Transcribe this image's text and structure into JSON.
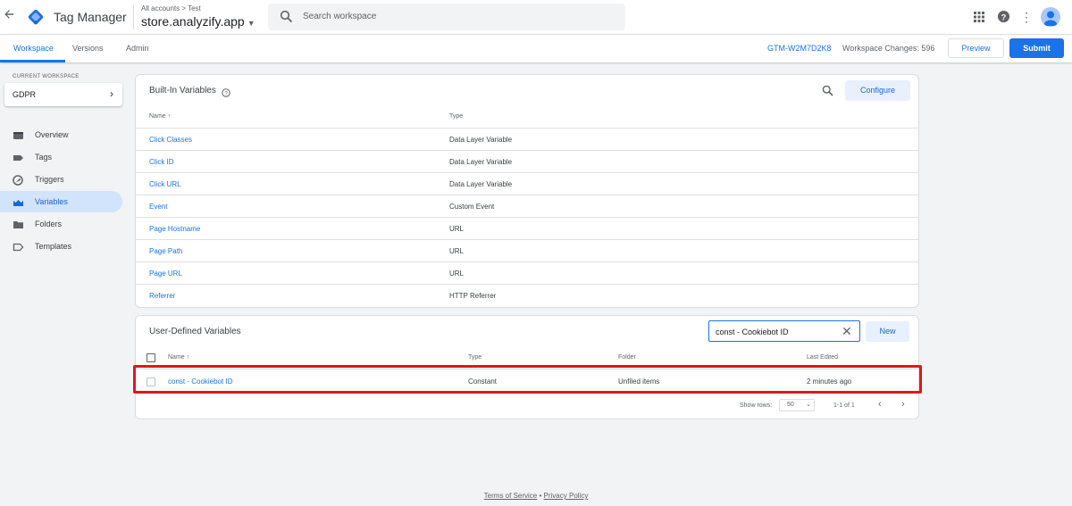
{
  "app": {
    "name": "Tag Manager",
    "breadcrumb": "All accounts > Test",
    "container": "store.analyzify.app"
  },
  "search": {
    "placeholder": "Search workspace"
  },
  "tabs": [
    {
      "label": "Workspace"
    },
    {
      "label": "Versions"
    },
    {
      "label": "Admin"
    }
  ],
  "header": {
    "container_id": "GTM-W2M7D2K8",
    "workspace_changes": "Workspace Changes: 596",
    "preview": "Preview",
    "submit": "Submit"
  },
  "sidebar": {
    "current_workspace_label": "CURRENT WORKSPACE",
    "workspace_name": "GDPR",
    "items": [
      {
        "label": "Overview",
        "icon": "overview-icon"
      },
      {
        "label": "Tags",
        "icon": "tag-icon"
      },
      {
        "label": "Triggers",
        "icon": "trigger-icon"
      },
      {
        "label": "Variables",
        "icon": "variables-icon",
        "active": true
      },
      {
        "label": "Folders",
        "icon": "folder-icon"
      },
      {
        "label": "Templates",
        "icon": "template-icon"
      }
    ]
  },
  "builtin": {
    "title": "Built-In Variables",
    "configure": "Configure",
    "col_name": "Name ↑",
    "col_type": "Type",
    "rows": [
      {
        "name": "Click Classes",
        "type": "Data Layer Variable"
      },
      {
        "name": "Click ID",
        "type": "Data Layer Variable"
      },
      {
        "name": "Click URL",
        "type": "Data Layer Variable"
      },
      {
        "name": "Event",
        "type": "Custom Event"
      },
      {
        "name": "Page Hostname",
        "type": "URL"
      },
      {
        "name": "Page Path",
        "type": "URL"
      },
      {
        "name": "Page URL",
        "type": "URL"
      },
      {
        "name": "Referrer",
        "type": "HTTP Referrer"
      }
    ]
  },
  "user_defined": {
    "title": "User-Defined Variables",
    "filter_value": "const - Cookiebot ID",
    "new_button": "New",
    "col_name": "Name ↑",
    "col_type": "Type",
    "col_folder": "Folder",
    "col_last_edited": "Last Edited",
    "rows": [
      {
        "name": "const - Cookiebot ID",
        "type": "Constant",
        "folder": "Unfiled items",
        "last_edited": "2 minutes ago"
      }
    ],
    "pager": {
      "show_rows_label": "Show rows:",
      "rows_value": "50",
      "range": "1-1 of 1"
    }
  },
  "footer": {
    "terms": "Terms of Service",
    "dot": "•",
    "privacy": "Privacy Policy"
  },
  "colors": {
    "accent": "#1a73e8",
    "highlight": "#e4141b",
    "active_nav": "#d2e3fc"
  }
}
